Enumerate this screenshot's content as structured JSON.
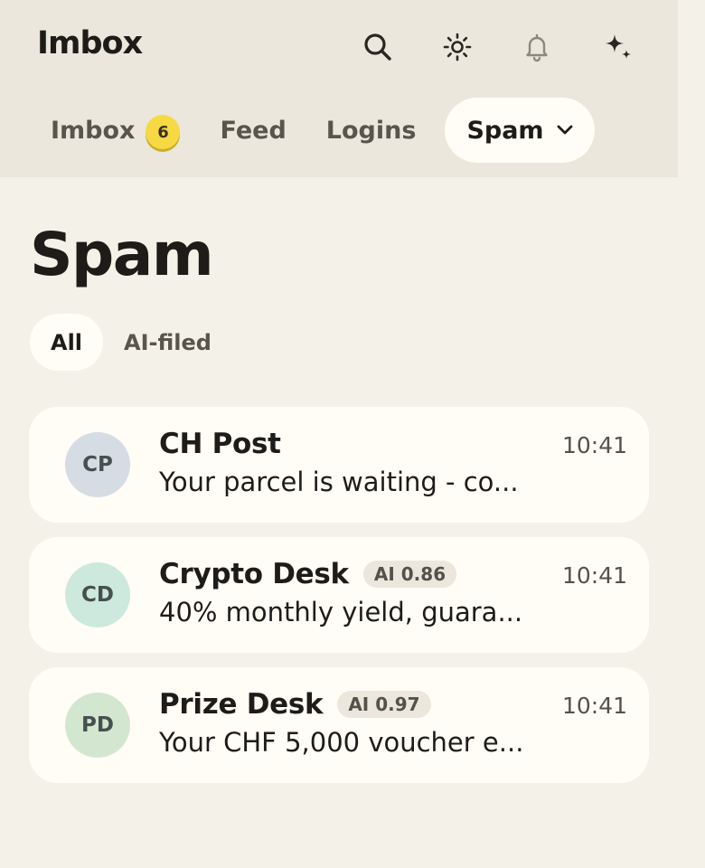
{
  "header": {
    "title": "Imbox",
    "icons": [
      "search-icon",
      "sun-icon",
      "bell-icon",
      "sparkle-icon"
    ]
  },
  "tabs": [
    {
      "label": "Imbox",
      "badge": "6"
    },
    {
      "label": "Feed"
    },
    {
      "label": "Logins"
    },
    {
      "label": "Spam",
      "active": true,
      "icon": "chevron-down-icon"
    }
  ],
  "main": {
    "title": "Spam",
    "filters": [
      {
        "label": "All",
        "active": true
      },
      {
        "label": "AI-filed"
      }
    ]
  },
  "messages": [
    {
      "initials": "CP",
      "sender": "CH Post",
      "ai_score": "",
      "time": "10:41",
      "preview": "Your parcel is waiting - co...",
      "avatar_color": "#d5dce4"
    },
    {
      "initials": "CD",
      "sender": "Crypto Desk",
      "ai_score": "AI 0.86",
      "time": "10:41",
      "preview": "40% monthly yield, guara...",
      "avatar_color": "#cde8dc"
    },
    {
      "initials": "PD",
      "sender": "Prize Desk",
      "ai_score": "AI 0.97",
      "time": "10:41",
      "preview": "Your CHF 5,000 voucher e...",
      "avatar_color": "#d3e6d0"
    }
  ],
  "colors": {
    "background": "#f4f1e8",
    "topbar": "#ebe7dd",
    "card": "#fffdf6",
    "badge": "#f7d943",
    "text": "#1e1c18"
  }
}
